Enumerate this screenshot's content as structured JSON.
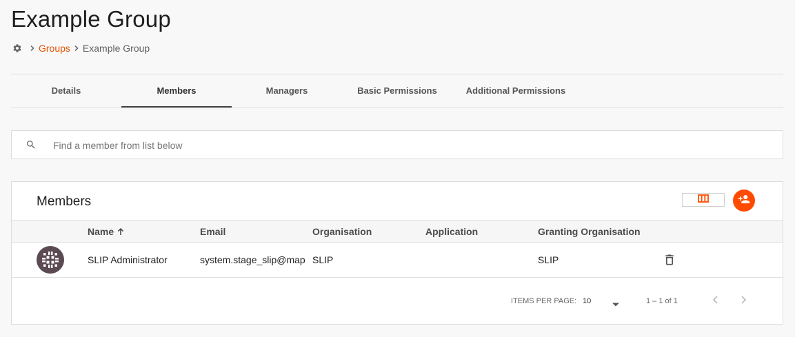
{
  "page": {
    "title": "Example Group"
  },
  "breadcrumb": {
    "items": [
      {
        "label": "Groups",
        "link": true
      },
      {
        "label": "Example Group",
        "link": false
      }
    ]
  },
  "tabs": [
    {
      "label": "Details"
    },
    {
      "label": "Members",
      "active": true
    },
    {
      "label": "Managers"
    },
    {
      "label": "Basic Permissions"
    },
    {
      "label": "Additional Permissions"
    }
  ],
  "search": {
    "placeholder": "Find a member from list below",
    "value": ""
  },
  "members": {
    "title": "Members",
    "columns": [
      "Name",
      "Email",
      "Organisation",
      "Application",
      "Granting Organisation"
    ],
    "sort": {
      "column": "Name",
      "direction": "ascending"
    },
    "rows": [
      {
        "name": "SLIP Administrator",
        "email": "system.stage_slip@map",
        "organisation": "SLIP",
        "application": "",
        "granting_organisation": "SLIP"
      }
    ]
  },
  "paginator": {
    "items_per_page_label": "ITEMS PER PAGE:",
    "page_size": "10",
    "range": "1 – 1 of 1"
  },
  "colors": {
    "accent": "#ff4b00",
    "link": "#e65100",
    "avatar": "#5b4a52"
  },
  "icons": [
    "gear-icon",
    "chevron-right-icon",
    "search-icon",
    "view-columns-icon",
    "add-person-icon",
    "arrow-up-icon",
    "trash-icon",
    "caret-down-icon",
    "chevron-left-icon"
  ]
}
